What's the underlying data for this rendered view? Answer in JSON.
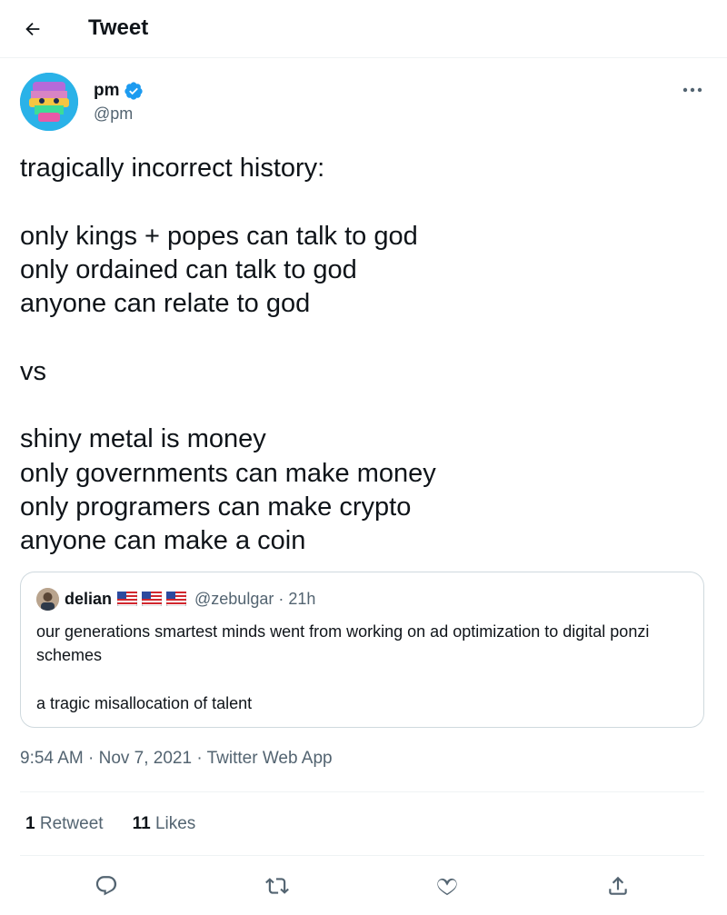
{
  "header": {
    "title": "Tweet"
  },
  "tweet": {
    "author": {
      "name": "pm",
      "handle": "@pm",
      "verified": true
    },
    "text": "tragically incorrect history:\n\nonly kings + popes can talk to god\nonly ordained can talk to god\nanyone can relate to god\n\nvs\n\nshiny metal is money\nonly governments can make money\nonly programers can make crypto\nanyone can make a coin",
    "quote": {
      "author_name": "delian",
      "handle_time": "@zebulgar · 21h",
      "text": "our generations smartest minds went from working on ad optimization to digital ponzi schemes\n\na tragic misallocation of talent"
    },
    "timestamp": "9:54 AM · Nov 7, 2021 · Twitter Web App",
    "stats": {
      "retweets": {
        "count": "1",
        "label": "Retweet"
      },
      "likes": {
        "count": "11",
        "label": "Likes"
      }
    }
  },
  "icons": {
    "back": "arrow-left-icon",
    "verified": "verified-badge-icon",
    "more": "more-horizontal-icon",
    "reply": "reply-icon",
    "retweet": "retweet-icon",
    "like": "heart-icon",
    "share": "share-icon"
  },
  "colors": {
    "accent": "#1d9bf0",
    "text": "#0f1419",
    "secondary": "#536471",
    "border": "#cfd9de"
  }
}
